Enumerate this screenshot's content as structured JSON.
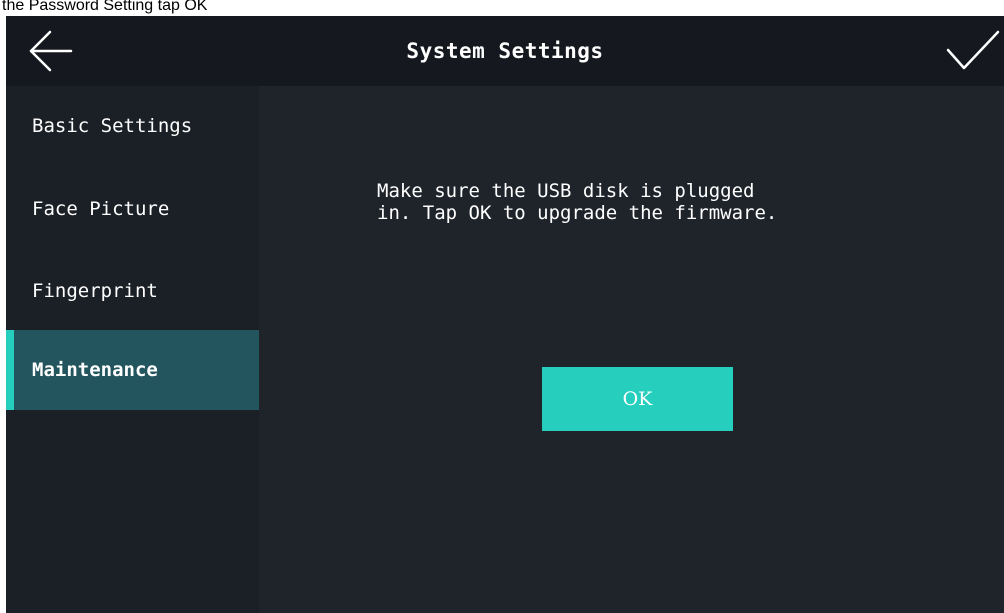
{
  "caption": "the Password Setting tap OK",
  "header": {
    "title": "System Settings",
    "back_icon": "back-arrow-icon",
    "confirm_icon": "checkmark-icon"
  },
  "sidebar": {
    "items": [
      {
        "label": "Basic Settings",
        "active": false
      },
      {
        "label": "Face Picture",
        "active": false
      },
      {
        "label": "Fingerprint",
        "active": false
      },
      {
        "label": "Maintenance",
        "active": true
      }
    ]
  },
  "main": {
    "message_line1": "Make sure the USB disk is plugged",
    "message_line2": "in. Tap OK to upgrade the firmware.",
    "ok_label": "OK"
  },
  "colors": {
    "background": "#1b2027",
    "titlebar": "#15191f",
    "content": "#1f242b",
    "accent": "#26cfbd",
    "active_item": "#23555e"
  }
}
